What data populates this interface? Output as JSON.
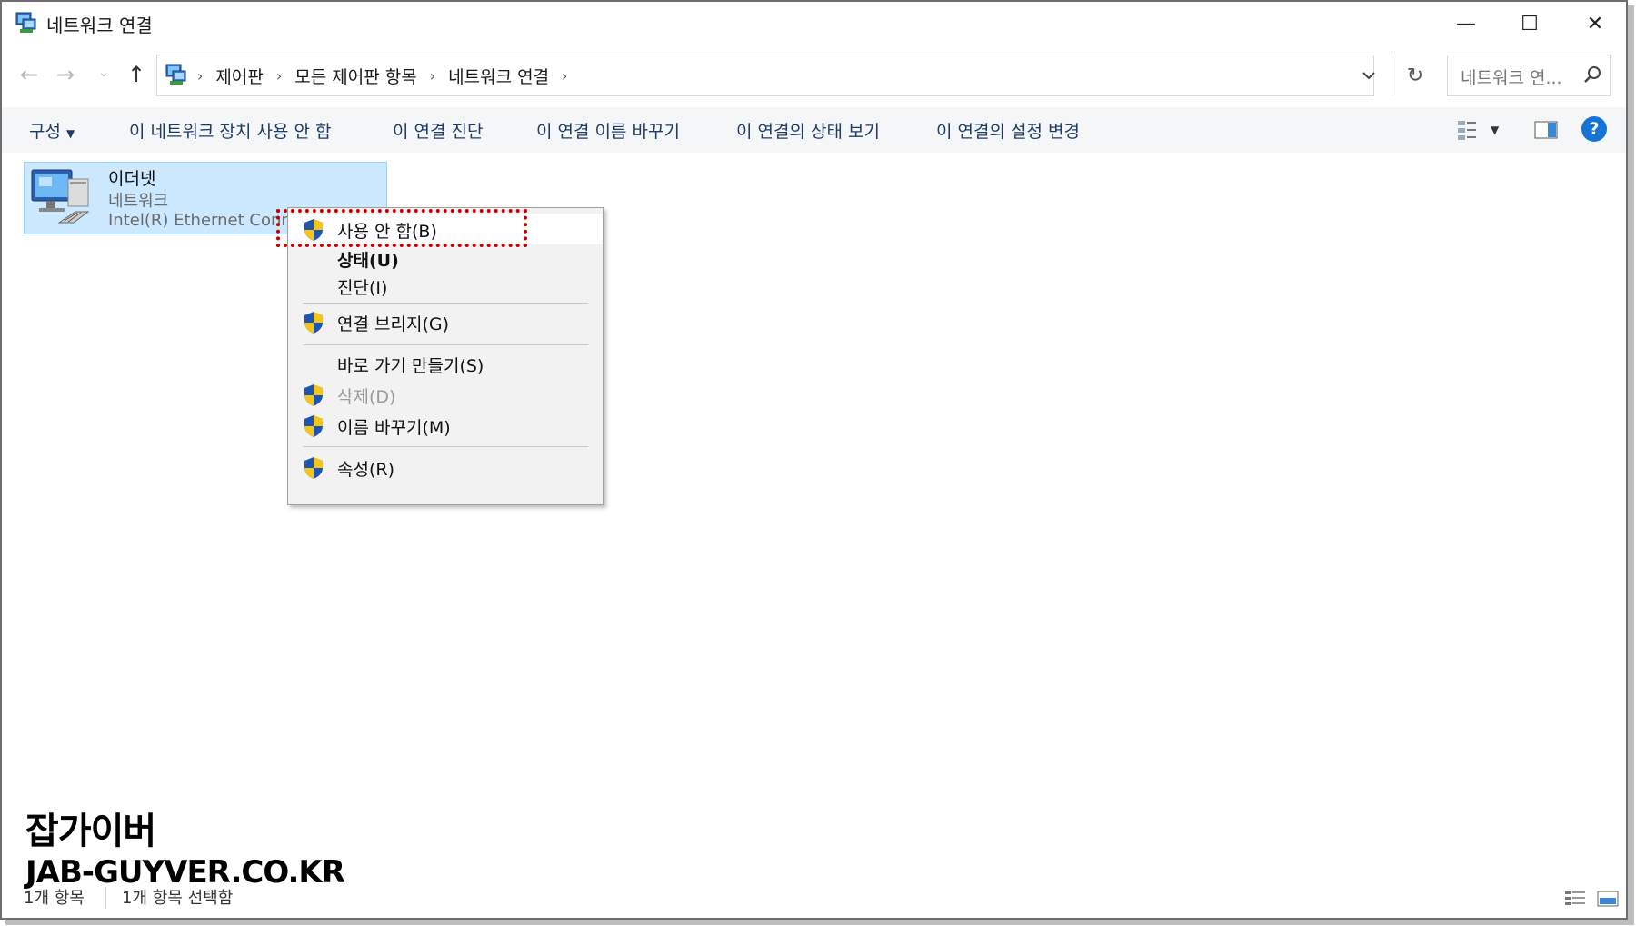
{
  "window": {
    "title": "네트워크 연결",
    "controls": {
      "minimize": "—",
      "maximize": "☐",
      "close": "✕"
    }
  },
  "address": {
    "back": "←",
    "forward": "→",
    "recent": "⌄",
    "up": "↑",
    "breadcrumbs": [
      "제어판",
      "모든 제어판 항목",
      "네트워크 연결"
    ],
    "separator": "›",
    "refresh": "↻"
  },
  "search": {
    "placeholder": "네트워크 연..."
  },
  "toolbar": {
    "organize": "구성",
    "commands": [
      "이 네트워크 장치 사용 안 함",
      "이 연결 진단",
      "이 연결 이름 바꾸기",
      "이 연결의 상태 보기",
      "이 연결의 설정 변경"
    ],
    "help": "?"
  },
  "connection": {
    "name": "이더넷",
    "type": "네트워크",
    "device": "Intel(R) Ethernet Conne"
  },
  "context_menu": {
    "items": [
      {
        "label": "사용 안 함(B)",
        "shield": true,
        "state": "hover"
      },
      {
        "label": "상태(U)",
        "shield": false,
        "state": "default-bold"
      },
      {
        "label": "진단(I)",
        "shield": false,
        "state": "normal"
      },
      {
        "label": "연결 브리지(G)",
        "shield": true,
        "state": "normal"
      },
      {
        "label": "바로 가기 만들기(S)",
        "shield": false,
        "state": "normal"
      },
      {
        "label": "삭제(D)",
        "shield": true,
        "state": "disabled"
      },
      {
        "label": "이름 바꾸기(M)",
        "shield": true,
        "state": "normal"
      },
      {
        "label": "속성(R)",
        "shield": true,
        "state": "normal"
      }
    ]
  },
  "status_bar": {
    "item_count": "1개 항목",
    "selected": "1개 항목 선택함"
  },
  "watermark": {
    "line1": "잡가이버",
    "line2": "JAB-GUYVER.CO.KR"
  },
  "colors": {
    "selection_bg": "#cce8ff",
    "command_text": "#1f3c66",
    "highlight_border": "#c40000",
    "help_blue": "#1673d8"
  },
  "icons": [
    "network-connections-icon",
    "shield-icon",
    "search-icon",
    "help-icon",
    "ethernet-adapter-icon"
  ]
}
